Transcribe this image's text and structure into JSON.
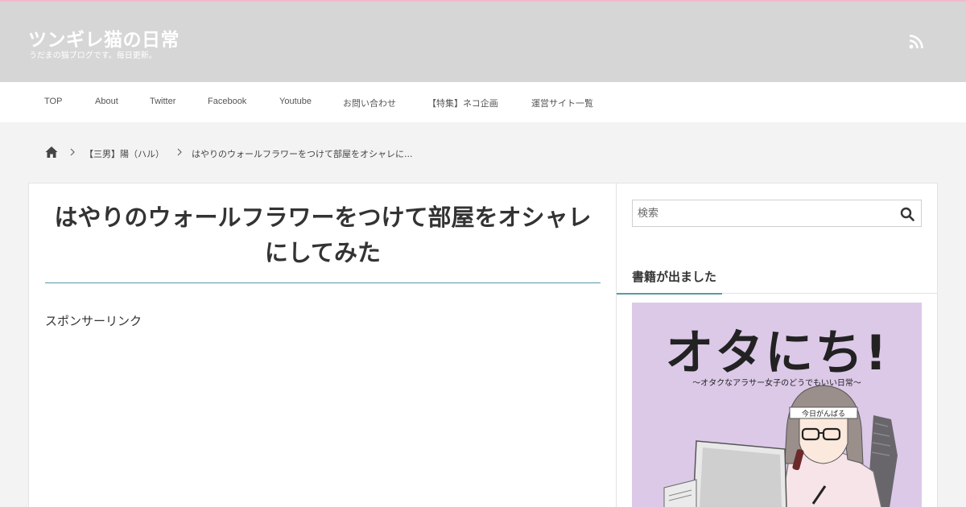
{
  "site": {
    "title": "ツンギレ猫の日常",
    "description": "うだまの猫ブログです。毎日更新。"
  },
  "nav": [
    {
      "label": "TOP"
    },
    {
      "label": "About"
    },
    {
      "label": "Twitter"
    },
    {
      "label": "Facebook"
    },
    {
      "label": "Youtube"
    },
    {
      "label": "お問い合わせ"
    },
    {
      "label": "【特集】ネコ企画"
    },
    {
      "label": "運営サイト一覧"
    }
  ],
  "breadcrumb": {
    "home_icon": "home-icon",
    "category": "【三男】陽（ハル）",
    "current": "はやりのウォールフラワーをつけて部屋をオシャレに..."
  },
  "post": {
    "title": "はやりのウォールフラワーをつけて部屋をオシャレにしてみた",
    "sponsor_label": "スポンサーリンク"
  },
  "sidebar": {
    "search_placeholder": "検索",
    "widget_title": "書籍が出ました",
    "book": {
      "title": "オタにち!",
      "subtitle": "〜オタクなアラサー女子のどうでもいい日常〜",
      "headband_text": "今日がんばる"
    }
  },
  "colors": {
    "header_bg": "#d6d6d6",
    "accent": "#5a9aa5",
    "top_line": "#f4b8cc",
    "book_bg": "#dcc9e8"
  }
}
